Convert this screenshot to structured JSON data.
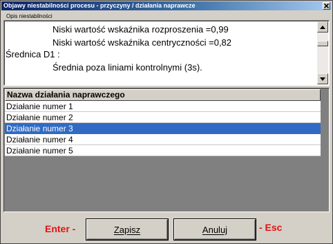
{
  "window": {
    "title": "Objawy niestabilności procesu - przyczyny / działania naprawcze",
    "close_icon": "close-icon"
  },
  "description": {
    "label": "Opis niestabilności",
    "lines": [
      "Niski wartość wskaźnika rozproszenia =0,99",
      "Niski wartość wskaźnika centryczności =0,82",
      "Średnica D1 :",
      "Średnia poza liniami kontrolnymi (3s)."
    ]
  },
  "actions_list": {
    "header": "Nazwa działania naprawczego",
    "items": [
      "Działanie numer 1",
      "Działanie numer 2",
      "Działanie numer 3",
      "Działanie numer 4",
      "Działanie numer 5"
    ],
    "selected_index": 2
  },
  "footer": {
    "enter_label": "Enter -",
    "save_button": "Zapisz",
    "cancel_button": "Anuluj",
    "esc_label": "- Esc"
  },
  "colors": {
    "title_bar": "#0a246a",
    "selection": "#316ac5",
    "key_label": "#e01414",
    "list_background": "#808080"
  }
}
